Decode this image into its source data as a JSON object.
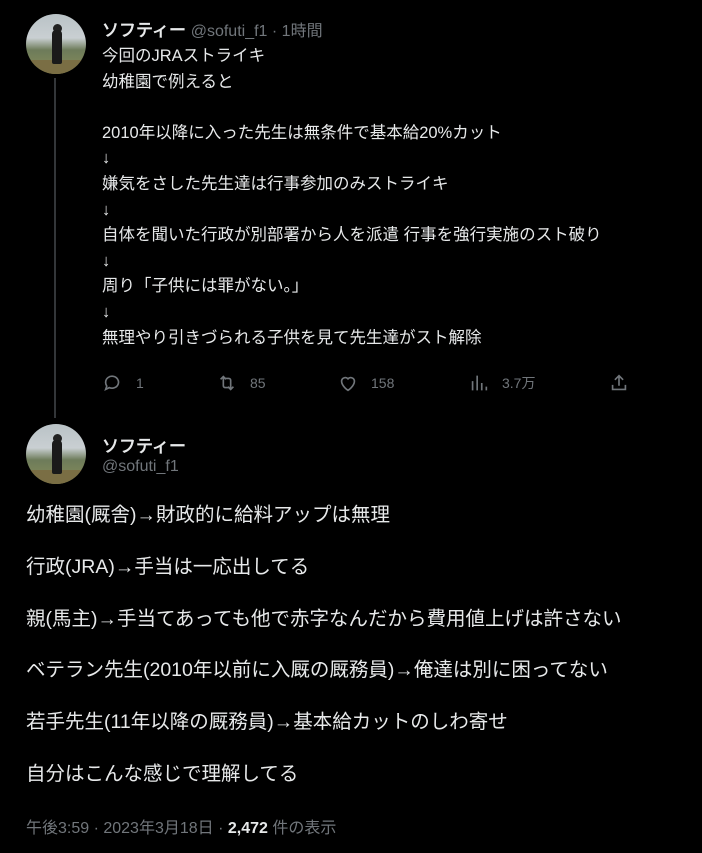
{
  "tweet1": {
    "display_name": "ソフティー",
    "handle": "@sofuti_f1",
    "time": "1時間",
    "body": "今回のJRAストライキ\n幼稚園で例えると\n\n2010年以降に入った先生は無条件で基本給20%カット\n↓\n嫌気をさした先生達は行事参加のみストライキ\n↓\n自体を聞いた行政が別部署から人を派遣 行事を強行実施のスト破り\n↓\n周り「子供には罪がない。」\n↓\n無理やり引きづられる子供を見て先生達がスト解除",
    "replies": "1",
    "retweets": "85",
    "likes": "158",
    "views": "3.7万"
  },
  "tweet2": {
    "display_name": "ソフティー",
    "handle": "@sofuti_f1",
    "body": "幼稚園(厩舎)→財政的に給料アップは無理\n\n行政(JRA)→手当は一応出してる\n\n親(馬主)→手当てあっても他で赤字なんだから費用値上げは許さない\n\nベテラン先生(2010年以前に入厩の厩務員)→俺達は別に困ってない\n\n若手先生(11年以降の厩務員)→基本給カットのしわ寄せ\n\n自分はこんな感じで理解してる",
    "timestamp": "午後3:59 · 2023年3月18日 · ",
    "view_count": "2,472",
    "view_label": " 件の表示"
  }
}
